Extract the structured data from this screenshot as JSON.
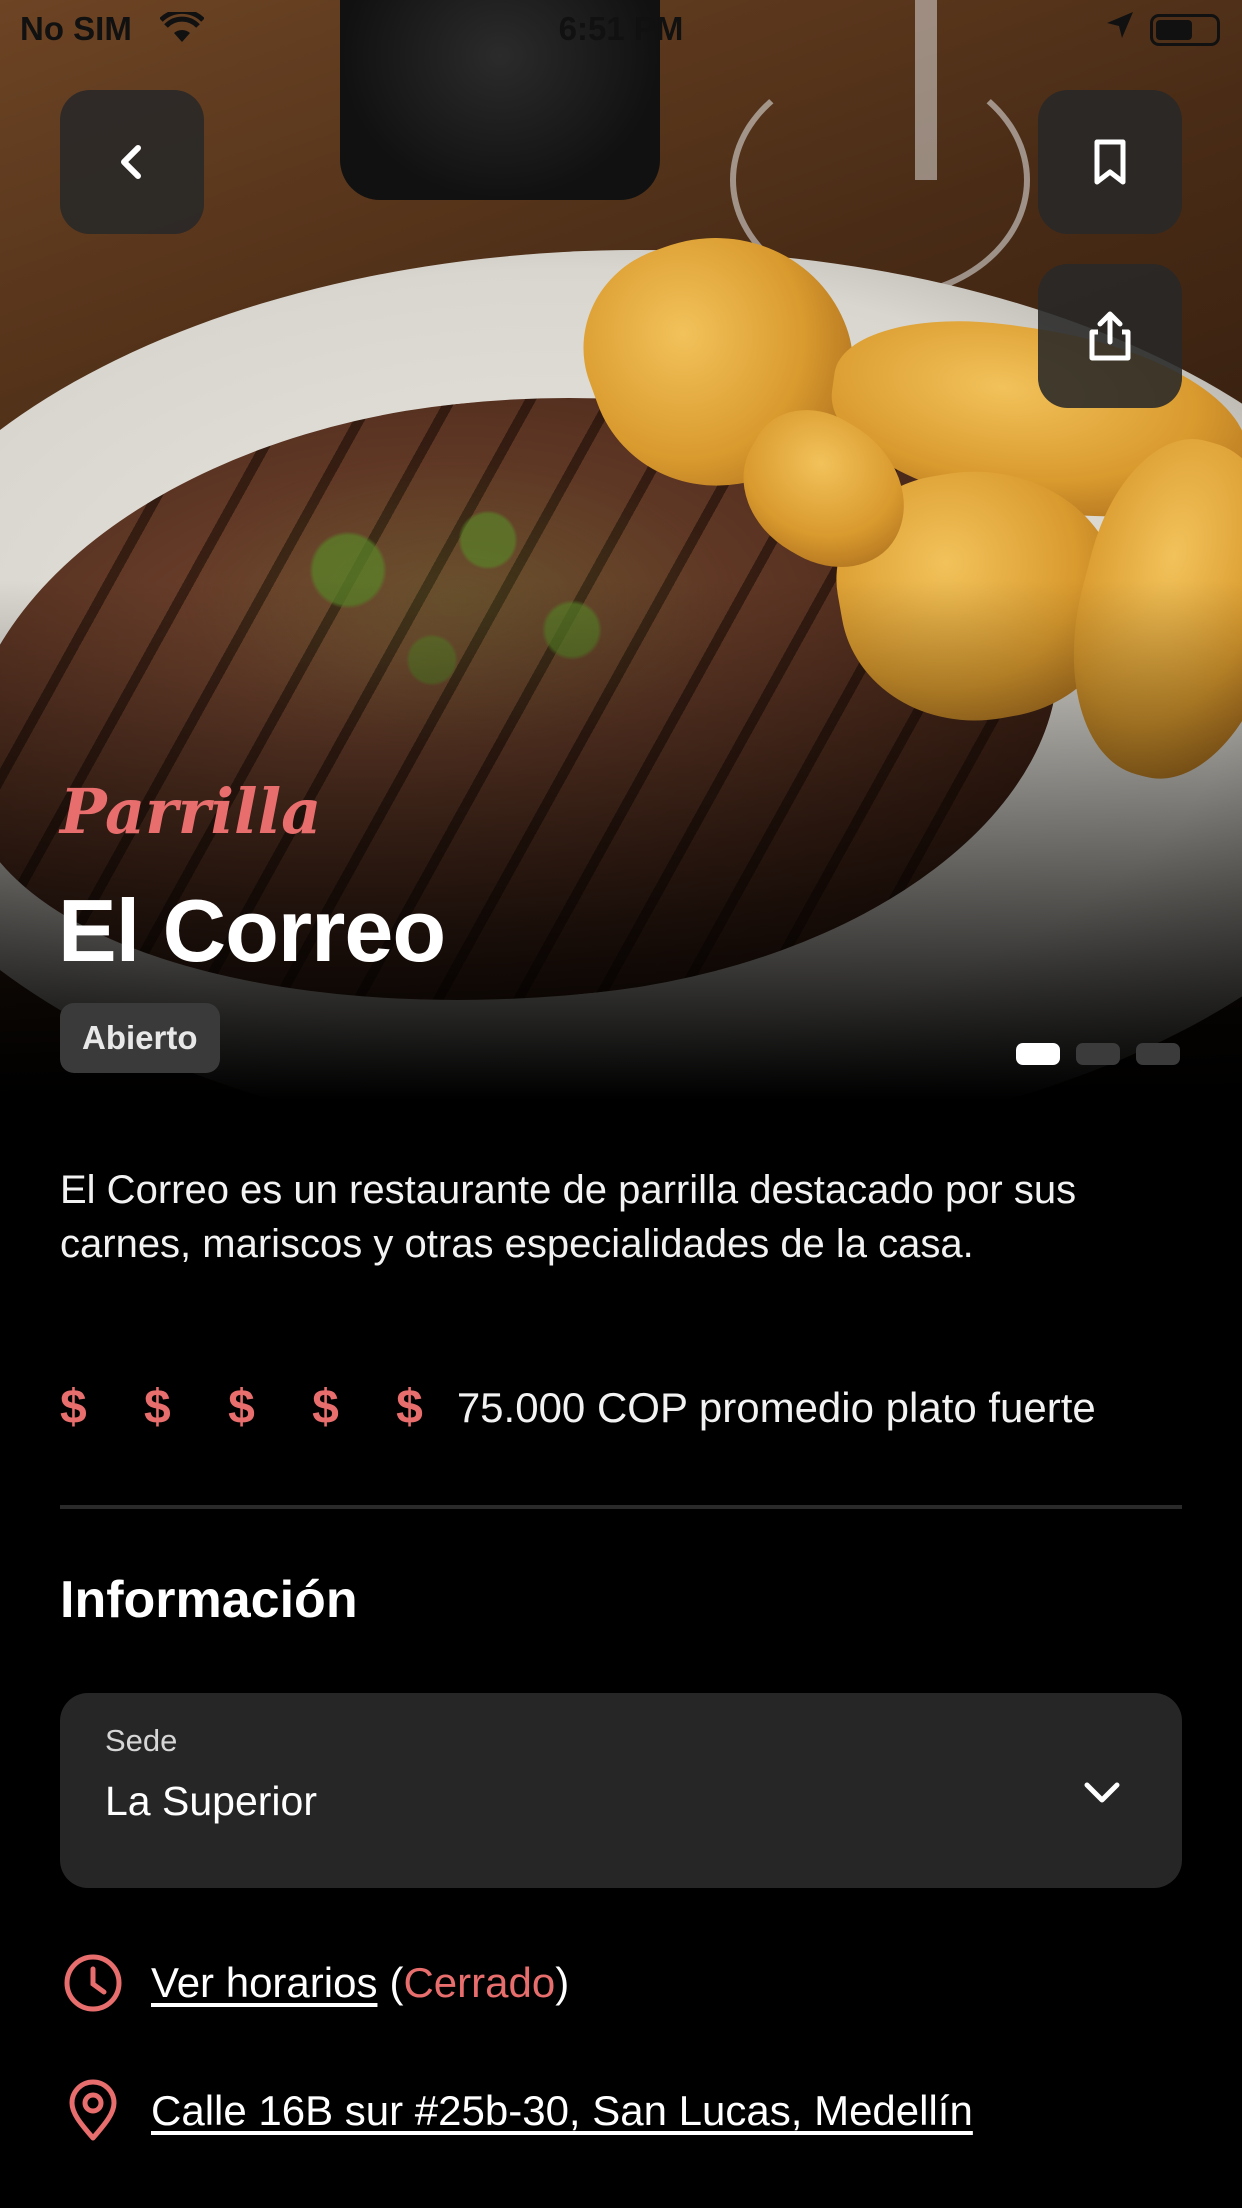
{
  "status_bar": {
    "carrier": "No SIM",
    "time": "6:51 PM"
  },
  "hero": {
    "category": "Parrilla",
    "name": "El Correo",
    "status_badge": "Abierto",
    "carousel": {
      "total": 3,
      "active_index": 0
    }
  },
  "description": "El Correo es un restaurante de parrilla destacado por sus carnes, mariscos y otras especialidades de la casa.",
  "price": {
    "signs": "$ $ $ $ $",
    "average_text": "75.000 COP promedio plato fuerte"
  },
  "information": {
    "title": "Información",
    "branch_select": {
      "label": "Sede",
      "value": "La Superior"
    },
    "schedule": {
      "link_text": "Ver horarios",
      "status_text": "Cerrado",
      "open_paren": "(",
      "close_paren": ")"
    },
    "address": "Calle 16B sur #25b-30, San Lucas, Medellín"
  },
  "colors": {
    "accent": "#e86d6d",
    "background": "#000000",
    "card": "#262626"
  },
  "icons": {
    "back": "chevron-left-icon",
    "bookmark": "bookmark-icon",
    "share": "share-icon",
    "clock": "clock-icon",
    "location": "location-pin-icon",
    "dropdown": "chevron-down-icon"
  }
}
